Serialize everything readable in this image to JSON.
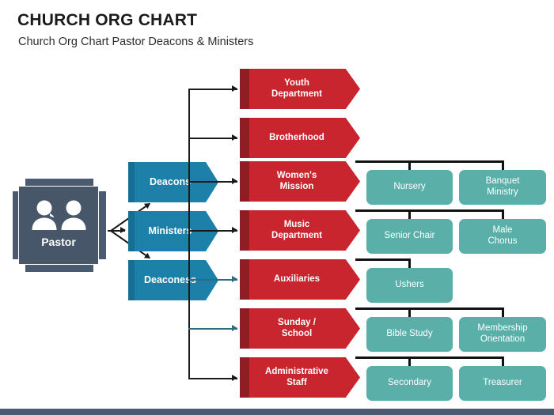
{
  "header": {
    "title": "CHURCH ORG CHART",
    "subtitle": "Church Org Chart Pastor Deacons & Ministers"
  },
  "colors": {
    "red": "#C9252E",
    "red_dark": "#8F1D23",
    "blue": "#1D80A8",
    "blue_dark": "#166F92",
    "teal": "#5AAFA9",
    "slate": "#4A5A70",
    "connector": "#1A1A1A",
    "connector_accent": "#2B6B83",
    "background": "#FFFFFF"
  },
  "root": {
    "label": "Pastor",
    "icon": "two-people-icon"
  },
  "tier1": [
    {
      "label": "Deacons"
    },
    {
      "label": "Ministers"
    },
    {
      "label": "Deaconess"
    }
  ],
  "tier2": [
    {
      "label": "Youth Department",
      "line1": "Youth",
      "line2": "Department"
    },
    {
      "label": "Brotherhood",
      "line1": "Brotherhood",
      "line2": ""
    },
    {
      "label": "Women's Mission",
      "line1": "Women's",
      "line2": "Mission"
    },
    {
      "label": "Music Department",
      "line1": "Music",
      "line2": "Department"
    },
    {
      "label": "Auxiliaries",
      "line1": "Auxiliaries",
      "line2": ""
    },
    {
      "label": "Sunday / School",
      "line1": "Sunday /",
      "line2": "School"
    },
    {
      "label": "Administrative Staff",
      "line1": "Administrative",
      "line2": "Staff"
    }
  ],
  "tier3": [
    {
      "parent": "Women's Mission",
      "left": "Nursery",
      "right": "Banquet Ministry",
      "left_l1": "Nursery",
      "left_l2": "",
      "right_l1": "Banquet",
      "right_l2": "Ministry"
    },
    {
      "parent": "Music Department",
      "left": "Senior Chair",
      "right": "Male Chorus",
      "left_l1": "Senior Chair",
      "left_l2": "",
      "right_l1": "Male",
      "right_l2": "Chorus"
    },
    {
      "parent": "Auxiliaries",
      "left": "Ushers",
      "right": "",
      "left_l1": "Ushers",
      "left_l2": "",
      "right_l1": "",
      "right_l2": ""
    },
    {
      "parent": "Sunday / School",
      "left": "Bible Study",
      "right": "Membership Orientation",
      "left_l1": "Bible Study",
      "left_l2": "",
      "right_l1": "Membership",
      "right_l2": "Orientation"
    },
    {
      "parent": "Administrative Staff",
      "left": "Secondary",
      "right": "Treasurer",
      "left_l1": "Secondary",
      "left_l2": "",
      "right_l1": "Treasurer",
      "right_l2": ""
    }
  ]
}
